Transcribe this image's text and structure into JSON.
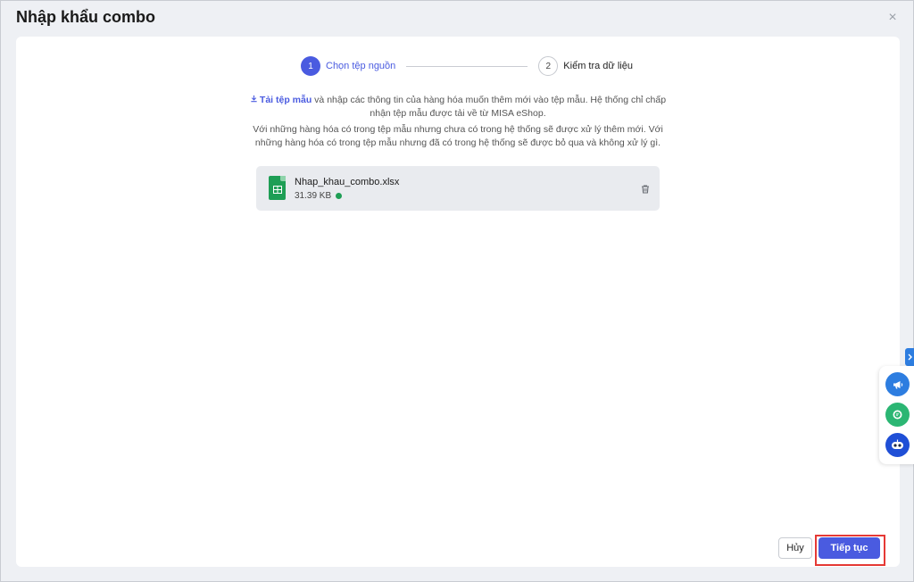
{
  "dialog": {
    "title": "Nhập khẩu combo",
    "close_label": "×"
  },
  "stepper": {
    "steps": [
      {
        "number": "1",
        "label": "Chọn tệp nguồn",
        "active": true
      },
      {
        "number": "2",
        "label": "Kiểm tra dữ liệu",
        "active": false
      }
    ]
  },
  "instructions": {
    "download_link": "Tải tệp mẫu",
    "line1_rest": " và nhập các thông tin của hàng hóa muốn thêm mới vào tệp mẫu. Hệ thống chỉ chấp nhận tệp mẫu được tải về từ MISA eShop.",
    "line2": "Với những hàng hóa có trong tệp mẫu nhưng chưa có trong hệ thống sẽ được xử lý thêm mới. Với những hàng hóa có trong tệp mẫu nhưng đã có trong hệ thống sẽ được bỏ qua và không xử lý gì."
  },
  "file": {
    "name": "Nhap_khau_combo.xlsx",
    "size": "31.39 KB",
    "icon": "spreadsheet-icon",
    "status_color": "#1e9e55"
  },
  "actions": {
    "cancel": "Hủy",
    "next": "Tiếp tục"
  },
  "side_widget": {
    "toggle_icon": "chevron-right-icon",
    "buttons": [
      "megaphone-icon",
      "chat-icon",
      "assistant-bot-icon"
    ]
  },
  "colors": {
    "accent": "#4a5be0",
    "highlight": "#e53935",
    "success": "#1e9e55"
  }
}
